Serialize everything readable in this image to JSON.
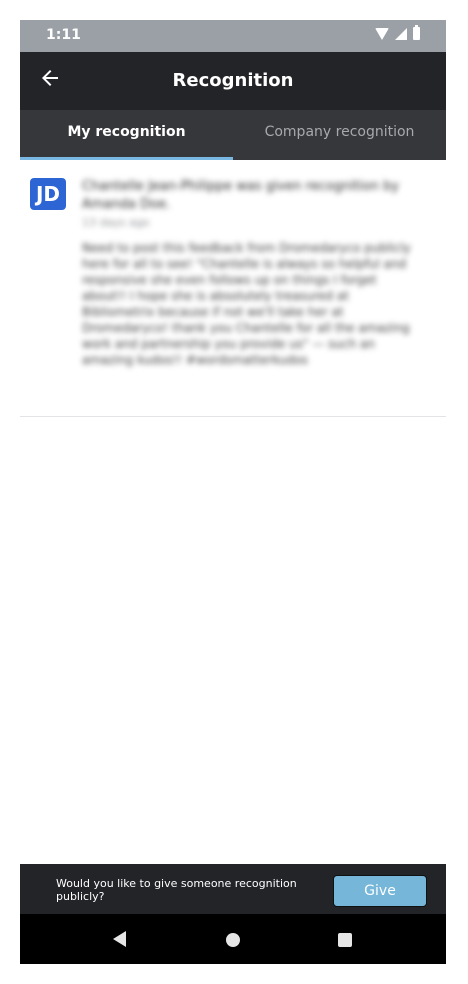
{
  "status_bar": {
    "time": "1:11"
  },
  "app_bar": {
    "title": "Recognition",
    "back_icon": "arrow-left-icon"
  },
  "tabs": [
    {
      "label": "My recognition",
      "active": true
    },
    {
      "label": "Company recognition",
      "active": false
    }
  ],
  "recognition_item": {
    "avatar_initials": "JD",
    "avatar_color": "#2e65d4",
    "headline": "Chantelle Jean-Philippe was given recognition by Amanda Doe.",
    "timestamp": "13 days ago",
    "message": "Need to post this feedback from Dromedaryco publicly here for all to see! \"Chantelle is always so helpful and responsive she even follows up on things I forget about!! I hope she is absolutely treasured at Bibliometrix because if not we'll take her at Dromedaryco! thank you Chantelle for all the amazing work and partnership you provide us\" — such an amazing kudos!! #wordsmatterkudos"
  },
  "bottom_prompt": {
    "text": "Would you like to give someone recognition publicly?",
    "button_label": "Give",
    "button_color": "#75b6d9"
  },
  "colors": {
    "app_bar_bg": "#232428",
    "tab_bar_bg": "#36373b",
    "tab_indicator": "#79b8e3"
  }
}
